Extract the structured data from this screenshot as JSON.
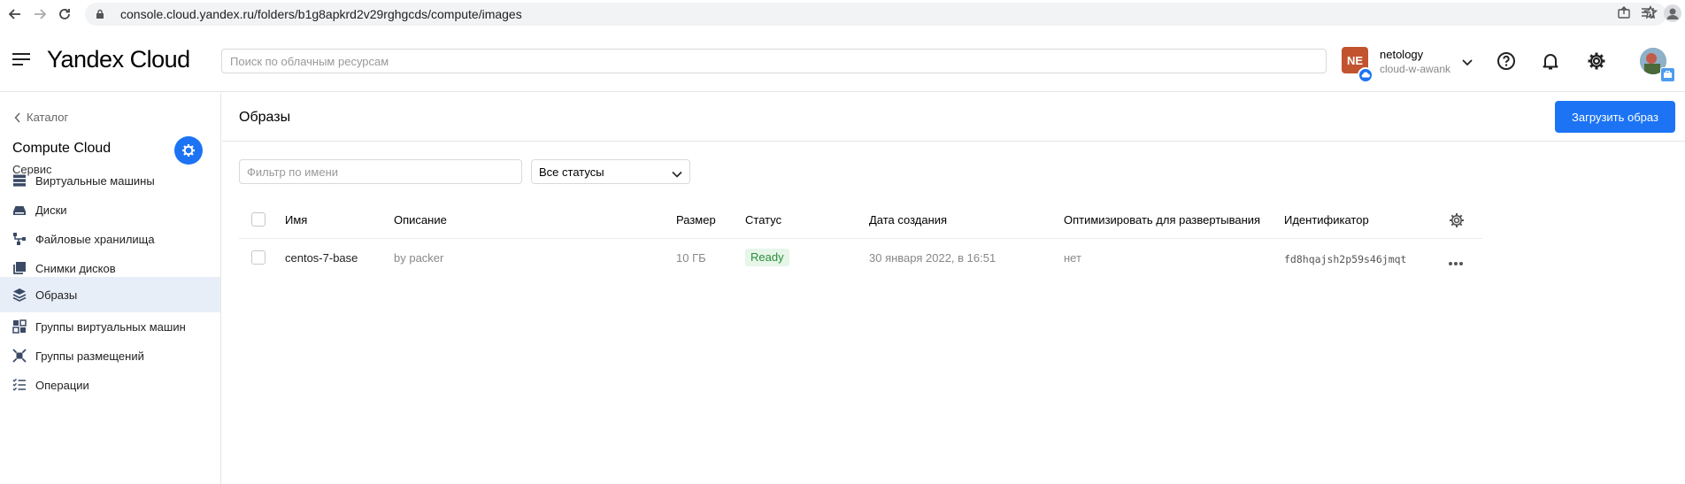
{
  "browser": {
    "url": "console.cloud.yandex.ru/folders/b1g8apkrd2v29rghgcds/compute/images"
  },
  "header": {
    "logo": "Yandex Cloud",
    "search_placeholder": "Поиск по облачным ресурсам",
    "account_initials": "NE",
    "account_name": "netology",
    "account_cloud": "cloud-w-awank"
  },
  "sidebar": {
    "back_label": "Каталог",
    "service_title": "Compute Cloud",
    "service_subtitle": "Сервис",
    "items": [
      {
        "label": "Виртуальные машины",
        "icon": "servers-icon"
      },
      {
        "label": "Диски",
        "icon": "disk-icon"
      },
      {
        "label": "Файловые хранилища",
        "icon": "file-storage-icon"
      },
      {
        "label": "Снимки дисков",
        "icon": "snapshots-icon"
      },
      {
        "label": "Образы",
        "icon": "layers-icon",
        "active": true
      },
      {
        "label": "Группы виртуальных машин",
        "icon": "instance-groups-icon"
      },
      {
        "label": "Группы размещений",
        "icon": "placement-groups-icon"
      },
      {
        "label": "Операции",
        "icon": "operations-list-icon"
      }
    ]
  },
  "main": {
    "title": "Образы",
    "upload_button": "Загрузить образ",
    "filter_placeholder": "Фильтр по имени",
    "status_filter": "Все статусы",
    "columns": {
      "name": "Имя",
      "description": "Описание",
      "size": "Размер",
      "status": "Статус",
      "created": "Дата создания",
      "optimize": "Оптимизировать для развертывания",
      "id": "Идентификатор"
    },
    "rows": [
      {
        "name": "centos-7-base",
        "description": "by packer",
        "size": "10 ГБ",
        "status": "Ready",
        "created": "30 января 2022, в 16:51",
        "optimize": "нет",
        "id": "fd8hqajsh2p59s46jmqt"
      }
    ]
  },
  "colors": {
    "accent": "#1c74f4",
    "active_bg": "#e8eef7",
    "ready_bg": "#e6f6e8",
    "ready_text": "#2a8d3c"
  }
}
